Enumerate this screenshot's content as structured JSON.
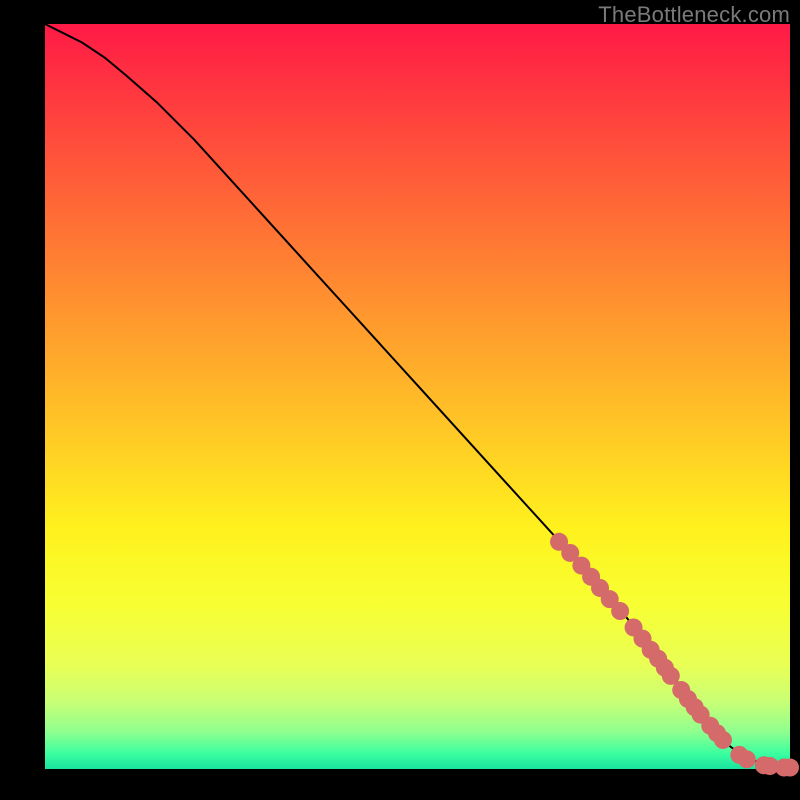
{
  "watermark": "TheBottleneck.com",
  "chart_data": {
    "type": "line",
    "title": "",
    "xlabel": "",
    "ylabel": "",
    "xlim": [
      0,
      100
    ],
    "ylim": [
      0,
      100
    ],
    "grid": false,
    "legend": false,
    "series": [
      {
        "name": "curve",
        "draw_line": true,
        "draw_markers": false,
        "line_color": "#000000",
        "x": [
          0,
          2,
          5,
          8,
          11,
          15,
          20,
          25,
          30,
          35,
          40,
          45,
          50,
          55,
          60,
          65,
          70,
          75,
          80,
          85,
          88,
          90,
          92,
          94,
          96,
          98,
          100
        ],
        "y": [
          100,
          99,
          97.5,
          95.5,
          93,
          89.5,
          84.5,
          79,
          73.5,
          68,
          62.5,
          57,
          51.5,
          46,
          40.5,
          35,
          29.5,
          24,
          18,
          11.5,
          7.5,
          5,
          3,
          1.6,
          0.8,
          0.3,
          0.2
        ]
      },
      {
        "name": "points",
        "draw_line": false,
        "draw_markers": true,
        "marker_color": "#d46a6a",
        "marker_radius": 9,
        "x": [
          69,
          70.5,
          72,
          73.3,
          74.5,
          75.8,
          77.2,
          79,
          80.2,
          81.3,
          82.3,
          83.2,
          84,
          85.4,
          86.3,
          87.2,
          88,
          89.3,
          90.2,
          91,
          93.2,
          94.2,
          96.5,
          97.3,
          99.2,
          100
        ],
        "y": [
          30.5,
          29,
          27.3,
          25.8,
          24.3,
          22.8,
          21.2,
          19,
          17.5,
          16,
          14.8,
          13.6,
          12.5,
          10.6,
          9.4,
          8.3,
          7.3,
          5.8,
          4.8,
          3.9,
          1.9,
          1.3,
          0.5,
          0.4,
          0.2,
          0.2
        ]
      }
    ]
  }
}
